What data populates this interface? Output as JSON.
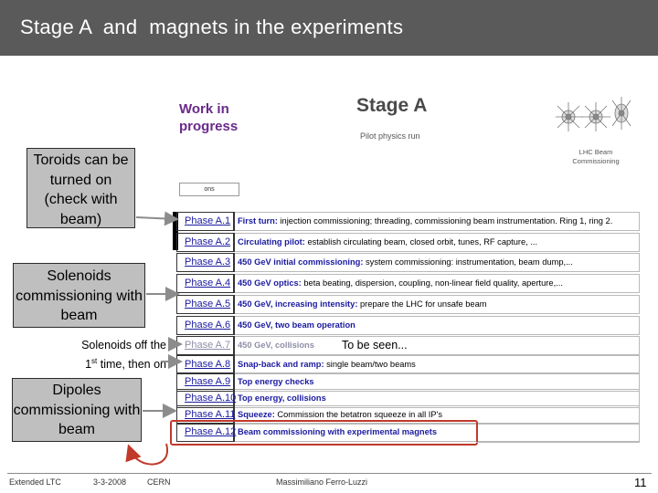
{
  "slide": {
    "title": "Stage A  and  magnets in the experiments",
    "page_number": "11"
  },
  "figure": {
    "work_in_progress_line1": "Work in",
    "work_in_progress_line2": "progress",
    "stage_title": "Stage A",
    "stage_subtitle": "Pilot physics run",
    "lhc_caption": "LHC Beam Commissioning",
    "pre_row_label": "ons"
  },
  "callouts": {
    "toroids": "Toroids can be turned on (check with beam)",
    "solenoids": "Solenoids commissioning with beam",
    "dipoles": "Dipoles commissioning with beam"
  },
  "notes": {
    "solenoids_off_line1": "Solenoids off the",
    "solenoids_off_ord": "1",
    "solenoids_off_sup": "st",
    "solenoids_off_line2": " time, then on",
    "to_be_seen": "To be seen..."
  },
  "phases": [
    {
      "phase": "Phase A.1",
      "title": "First turn:",
      "desc": " injection commissioning; threading, commissioning beam instrumentation. Ring 1, ring 2."
    },
    {
      "phase": "Phase A.2",
      "title": "Circulating pilot:",
      "desc": " establish circulating beam, closed orbit, tunes, RF capture, ..."
    },
    {
      "phase": "Phase A.3",
      "title": "450 GeV initial commissioning:",
      "desc": " system commissioning: instrumentation, beam dump,..."
    },
    {
      "phase": "Phase A.4",
      "title": "450 GeV optics:",
      "desc": " beta beating, dispersion, coupling, non-linear field quality, aperture,..."
    },
    {
      "phase": "Phase A.5",
      "title": "450 GeV, increasing intensity:",
      "desc": " prepare the LHC for unsafe beam"
    },
    {
      "phase": "Phase A.6",
      "title": "450 GeV, two beam operation",
      "desc": ""
    },
    {
      "phase": "Phase A.7",
      "title": "450 GeV, collisions",
      "desc": ""
    },
    {
      "phase": "Phase A.8",
      "title": "Snap-back and ramp:",
      "desc": " single beam/two beams"
    },
    {
      "phase": "Phase A.9",
      "title": "Top energy checks",
      "desc": ""
    },
    {
      "phase": "Phase A.10",
      "title": "Top energy, collisions",
      "desc": ""
    },
    {
      "phase": "Phase A.11",
      "title": "Squeeze:",
      "desc": " Commission the betatron squeeze in all IP's"
    },
    {
      "phase": "Phase A.12",
      "title": "Beam commissioning with experimental magnets",
      "desc": ""
    }
  ],
  "footer": {
    "conference": "Extended LTC",
    "date": "3-3-2008",
    "organization": "CERN",
    "author": "Massimiliano Ferro-Luzzi"
  },
  "colors": {
    "title_bar": "#5a5a5a",
    "callout_fill": "#bfbfbf",
    "phase_link": "#1a1aa0",
    "highlight": "#c0392b",
    "wip_text": "#6a2a8a"
  }
}
